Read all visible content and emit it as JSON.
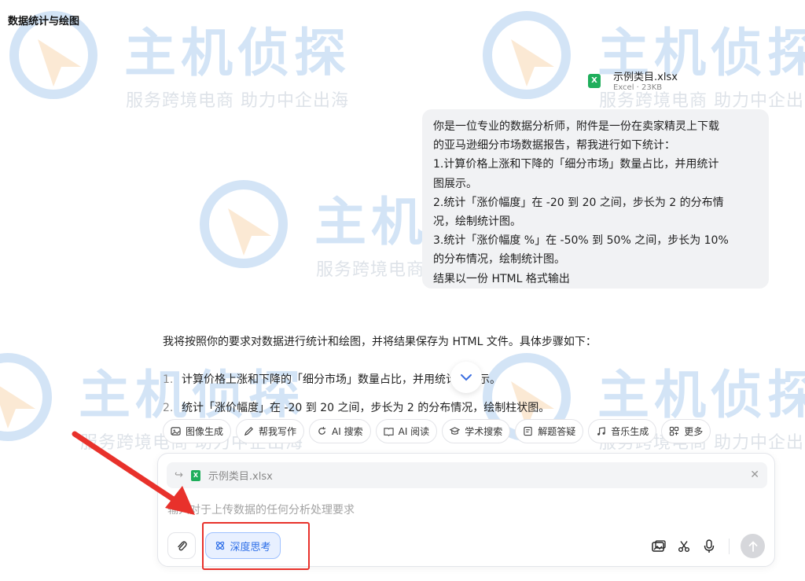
{
  "page": {
    "title": "数据统计与绘图"
  },
  "watermark": {
    "title": "主机侦探",
    "subtitle": "服务跨境电商 助力中企出海"
  },
  "attachment": {
    "filename": "示例类目.xlsx",
    "meta": "Excel · 23KB"
  },
  "user_message": {
    "lines": [
      "你是一位专业的数据分析师，附件是一份在卖家精灵上下载",
      "的亚马逊细分市场数据报告，帮我进行如下统计：",
      "1.计算价格上涨和下降的「细分市场」数量占比，并用统计",
      "图展示。",
      "2.统计「涨价幅度」在 -20 到 20 之间，步长为 2 的分布情",
      "况，绘制统计图。",
      "3.统计「涨价幅度 %」在 -50% 到 50% 之间，步长为 10%",
      "的分布情况，绘制统计图。",
      "结果以一份 HTML 格式输出"
    ]
  },
  "assistant": {
    "intro": "我将按照你的要求对数据进行统计和绘图，并将结果保存为 HTML 文件。具体步骤如下：",
    "steps": [
      {
        "num": "1.",
        "text": "计算价格上涨和下降的「细分市场」数量占比，并用统计图展示。"
      },
      {
        "num": "2.",
        "text": "统计「涨价幅度」在 -20 到 20 之间，步长为 2 的分布情况，绘制柱状图。"
      }
    ]
  },
  "tools": [
    {
      "label": "图像生成",
      "icon": "image-icon"
    },
    {
      "label": "帮我写作",
      "icon": "pen-icon"
    },
    {
      "label": "AI 搜索",
      "icon": "search-refresh-icon"
    },
    {
      "label": "AI 阅读",
      "icon": "book-icon"
    },
    {
      "label": "学术搜索",
      "icon": "graduation-cap-icon"
    },
    {
      "label": "解题答疑",
      "icon": "question-icon"
    },
    {
      "label": "音乐生成",
      "icon": "music-icon"
    },
    {
      "label": "更多",
      "icon": "grid-icon"
    }
  ],
  "composer": {
    "quoted_file": "示例类目.xlsx",
    "placeholder": "输入对于上传数据的任何分析处理要求",
    "deep_think_label": "深度思考"
  },
  "colors": {
    "accent": "#2e6fe8",
    "annotation": "#e8312b",
    "excel": "#1fae5b"
  }
}
